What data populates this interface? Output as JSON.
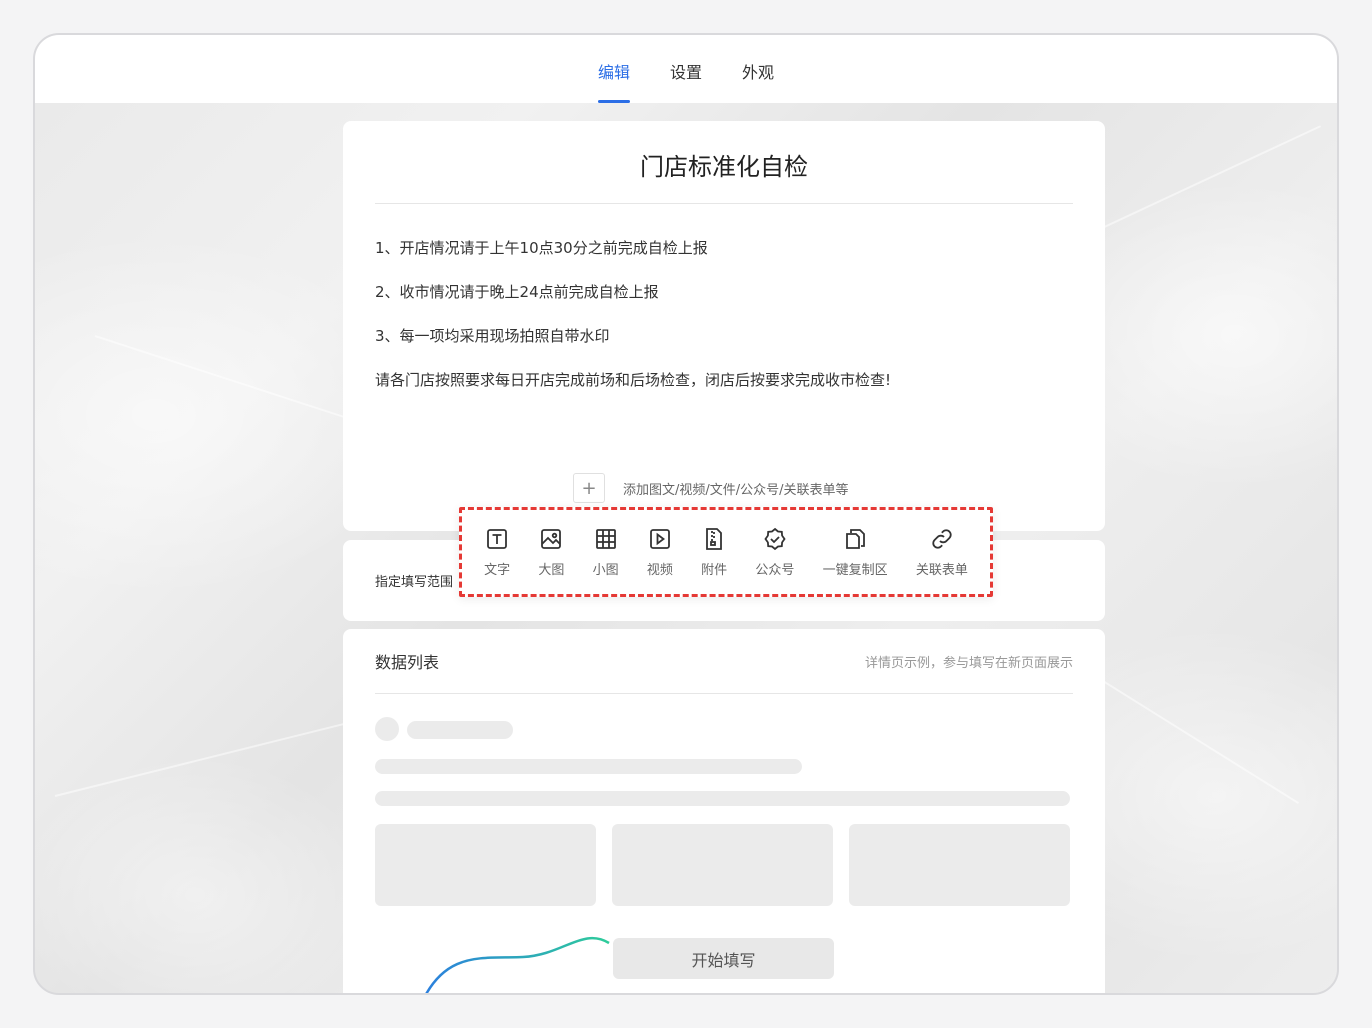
{
  "tabs": [
    {
      "label": "编辑",
      "active": true
    },
    {
      "label": "设置",
      "active": false
    },
    {
      "label": "外观",
      "active": false
    }
  ],
  "form": {
    "title": "门店标准化自检",
    "lines": [
      "1、开店情况请于上午10点30分之前完成自检上报",
      "2、收市情况请于晚上24点前完成自检上报",
      "3、每一项均采用现场拍照自带水印",
      "请各门店按照要求每日开店完成前场和后场检查，闭店后按要求完成收市检查!"
    ],
    "add_icon": "plus-icon",
    "add_hint": "添加图文/视频/文件/公众号/关联表单等"
  },
  "range": {
    "label": "指定填写范围"
  },
  "toolbar": {
    "items": [
      {
        "label": "文字",
        "icon": "text-icon"
      },
      {
        "label": "大图",
        "icon": "image-icon"
      },
      {
        "label": "小图",
        "icon": "grid-icon"
      },
      {
        "label": "视频",
        "icon": "video-icon"
      },
      {
        "label": "附件",
        "icon": "attachment-icon"
      },
      {
        "label": "公众号",
        "icon": "verified-badge-icon"
      },
      {
        "label": "一键复制区",
        "icon": "copy-icon"
      },
      {
        "label": "关联表单",
        "icon": "link-icon"
      }
    ],
    "highlight_color": "#e53935"
  },
  "data_list": {
    "title": "数据列表",
    "note": "详情页示例，参与填写在新页面展示",
    "start_button": "开始填写"
  },
  "colors": {
    "accent": "#2b6ee6",
    "skeleton": "#ebebeb"
  }
}
